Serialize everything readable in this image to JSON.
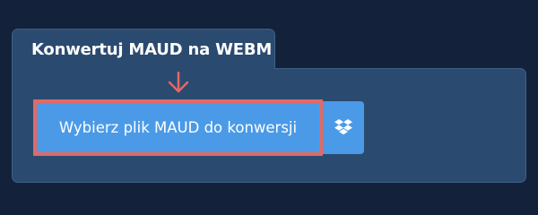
{
  "panel": {
    "tab_title": "Konwertuj MAUD na WEBM"
  },
  "actions": {
    "choose_file_label": "Wybierz plik MAUD do konwersji",
    "dropbox_icon": "dropbox-icon"
  },
  "colors": {
    "page_background": "#13223a",
    "panel_background": "#2b4a70",
    "button_background": "#4a9ae8",
    "highlight_border": "#e06a66",
    "arrow": "#e06a66"
  }
}
